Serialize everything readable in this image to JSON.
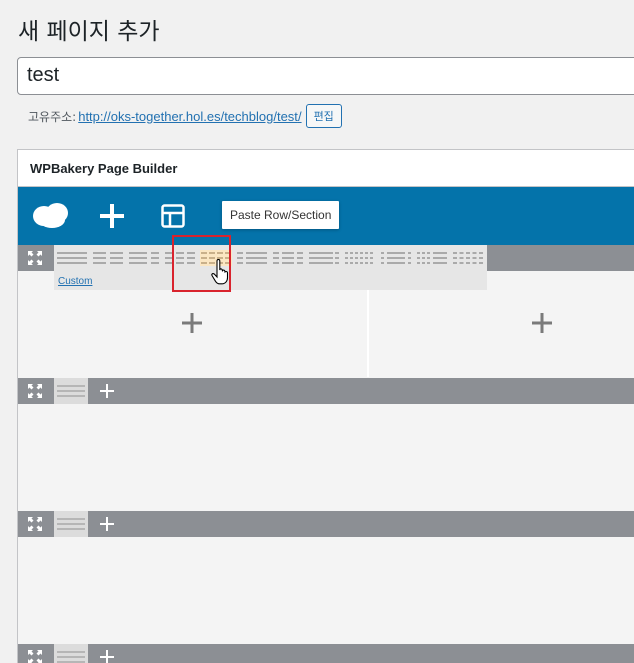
{
  "page": {
    "title": "새 페이지 추가"
  },
  "post_title": {
    "value": "test"
  },
  "permalink": {
    "label": "고유주소:",
    "url_base": "http://oks-together.hol.es/techblog/",
    "slug": "test",
    "url_trailing": "/",
    "edit_label": "편집"
  },
  "builder": {
    "header": "WPBakery Page Builder",
    "nav": {
      "logo_icon": "wpbakery-logo-icon",
      "add_icon": "plus-icon",
      "templates_icon": "layout-template-icon",
      "tooltip": "Paste Row/Section"
    },
    "row_layout_popup": {
      "custom_label": "Custom",
      "layouts": [
        "1/1",
        "1/2+1/2",
        "2/3+1/3",
        "1/3+1/3+1/3",
        "1/4+1/4+1/4+1/4",
        "1/4+3/4",
        "1/4+1/2+1/4",
        "5/6+1/6",
        "1/6+1/6+1/6+1/6+1/6+1/6",
        "1/6+4/6+1/6",
        "1/6+1/6+1/6+1/2",
        "1/5+1/5+1/5+1/5+1/5"
      ],
      "highlighted_index": 4
    },
    "colors": {
      "nav_bg": "#0473aa",
      "row_bar": "#8c8f94",
      "highlight_border": "#d9232d",
      "highlight_fill": "#fbe6c2"
    }
  }
}
